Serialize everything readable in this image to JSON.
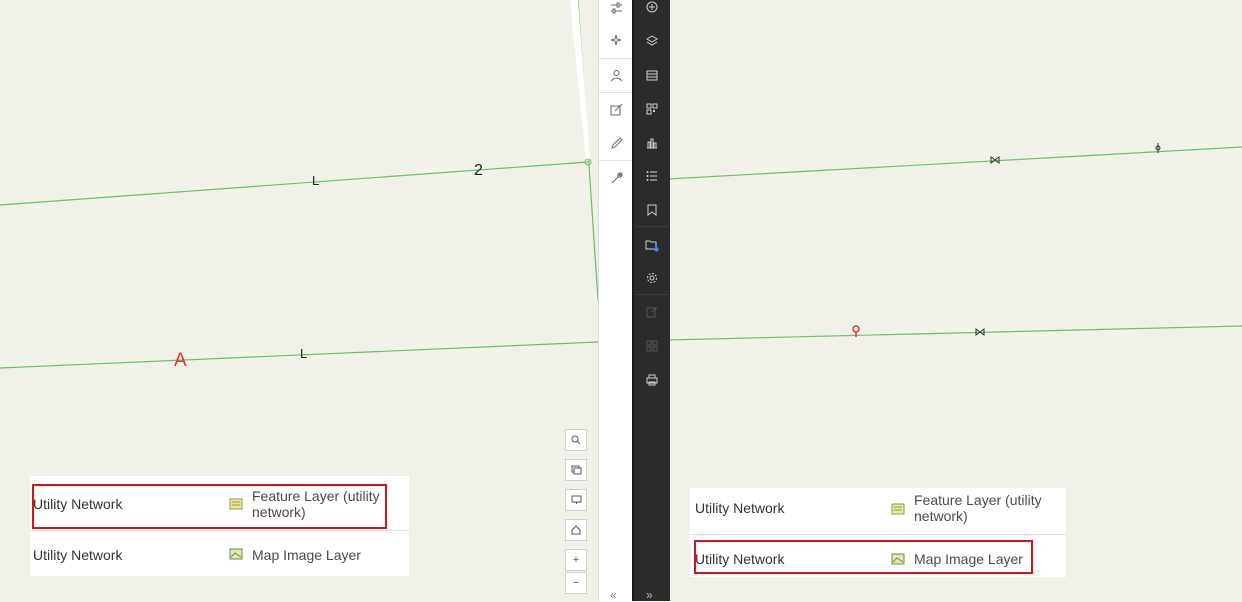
{
  "left_map": {
    "labels": [
      "L",
      "2",
      "A",
      "L"
    ]
  },
  "left_toolbar": {
    "tools": [
      "sliders-icon",
      "sparkle-icon",
      "user-group-icon",
      "edit-icon",
      "pen-icon",
      "wrench-icon"
    ],
    "collapse": "«"
  },
  "map_controls": {
    "zoom_in": "+",
    "zoom_out": "−"
  },
  "dark_toolbar": {
    "tools": [
      "add-circle-icon",
      "layers-icon",
      "table-icon",
      "qr-grid-icon",
      "bar-chart-icon",
      "list-icon",
      "bookmark-icon",
      "folder-badge-icon",
      "gear-icon",
      "export-icon",
      "grid-icon",
      "print-icon"
    ],
    "expand": "»"
  },
  "left_table": {
    "rows": [
      {
        "name": "Utility Network",
        "type": "Feature Layer (utility network)"
      },
      {
        "name": "Utility Network",
        "type": "Map Image Layer"
      }
    ]
  },
  "right_table": {
    "rows": [
      {
        "name": "Utility Network",
        "type": "Feature Layer (utility network)"
      },
      {
        "name": "Utility Network",
        "type": "Map Image Layer"
      }
    ]
  },
  "colors": {
    "map_bg": "#f1f0e9",
    "line": "#6cbf6a",
    "highlight": "#d3131a",
    "marker_red": "#e0342d",
    "dark_toolbar": "#2b2b2b"
  }
}
